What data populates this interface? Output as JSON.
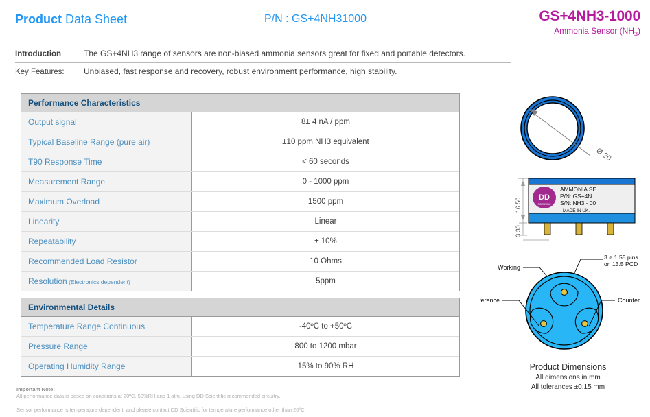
{
  "header": {
    "title_bold": "Product",
    "title_rest": " Data Sheet",
    "part_number": "P/N : GS+4NH31000",
    "model": "GS+4NH3-1000",
    "subtitle_main": "Ammonia Sensor (NH",
    "subtitle_sub": "3",
    "subtitle_end": ")",
    "brand_color": "#b5199c",
    "accent_color": "#2196f3"
  },
  "intro": {
    "label": "Introduction",
    "text": "The GS+4NH3 range of sensors are non-biased ammonia sensors great for fixed and portable detectors.",
    "features_label": "Key Features:",
    "features_text": "Unbiased, fast response and recovery, robust environment performance, high stability."
  },
  "performance": {
    "heading": "Performance Characteristics",
    "rows": [
      {
        "key": "Output signal",
        "note": "",
        "value": "8± 4 nA / ppm"
      },
      {
        "key": "Typical Baseline Range (pure air)",
        "note": "",
        "value": "±10 ppm NH3 equivalent"
      },
      {
        "key": "T90 Response Time",
        "note": "",
        "value": "< 60 seconds"
      },
      {
        "key": "Measurement Range",
        "note": "",
        "value": "0 - 1000 ppm"
      },
      {
        "key": "Maximum Overload",
        "note": "",
        "value": "1500 ppm"
      },
      {
        "key": "Linearity",
        "note": "",
        "value": "Linear"
      },
      {
        "key": "Repeatability",
        "note": "",
        "value": "± 10%"
      },
      {
        "key": "Recommended Load Resistor",
        "note": "",
        "value": "10 Ohms"
      },
      {
        "key": "Resolution",
        "note": "(Electronics dependent)",
        "value": "5ppm"
      }
    ]
  },
  "environment": {
    "heading": "Environmental Details",
    "rows": [
      {
        "key": "Temperature Range Continuous",
        "note": "",
        "value": "-40ºC to +50ºC"
      },
      {
        "key": "Pressure Range",
        "note": "",
        "value": "800 to 1200 mbar"
      },
      {
        "key": "Operating Humidity Range",
        "note": "",
        "value": "15% to 90% RH"
      }
    ]
  },
  "footnotes": {
    "title": "Important Note:",
    "line1": "All performance data is based on conditions at 20ºC, 50%RH and 1 atm, using DD Scientific recommended circuitry.",
    "line2": "Sensor performance is temperature dependent, and please contact DD Scientific for temperature performance other than 20ºC."
  },
  "drawings": {
    "top_view": {
      "diameter_label": "Ø 20"
    },
    "side_view": {
      "height_dim": "16.50",
      "pin_dim": "3.30",
      "logo_text": "DD",
      "logo_sub": "SCIENTIFIC",
      "label_line1": "AMMONIA SE",
      "label_line2": "P/N: GS+4N",
      "label_line3": "S/N: NH3 - 00",
      "label_line4": "MADE IN UK."
    },
    "pin_view": {
      "working": "Working",
      "reference": "Reference",
      "counter": "Counter",
      "pin_note_line1": "3 ø 1.55 pins",
      "pin_note_line2": "on 13.5 PCD"
    },
    "caption": {
      "title": "Product Dimensions",
      "line1": "All dimensions in mm",
      "line2": "All tolerances ±0.15 mm"
    }
  }
}
